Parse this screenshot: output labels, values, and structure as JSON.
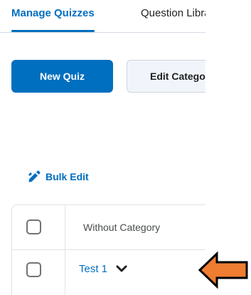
{
  "tabs": [
    {
      "label": "Manage Quizzes",
      "active": true
    },
    {
      "label": "Question Library",
      "active": false
    }
  ],
  "toolbar": {
    "new_quiz_label": "New Quiz",
    "edit_categories_label": "Edit Categories"
  },
  "bulk_edit": {
    "label": "Bulk Edit",
    "icon": "pencil-icon"
  },
  "table": {
    "header_label": "Without Category",
    "rows": [
      {
        "name": "Test 1",
        "icon": "chevron-down-icon"
      }
    ]
  },
  "annotation": {
    "icon": "arrow-left-icon",
    "fill_color": "#ee7d31",
    "stroke_color": "#000000"
  },
  "colors": {
    "accent": "#006fbf",
    "border": "#dfe3e8",
    "text": "#202122"
  }
}
